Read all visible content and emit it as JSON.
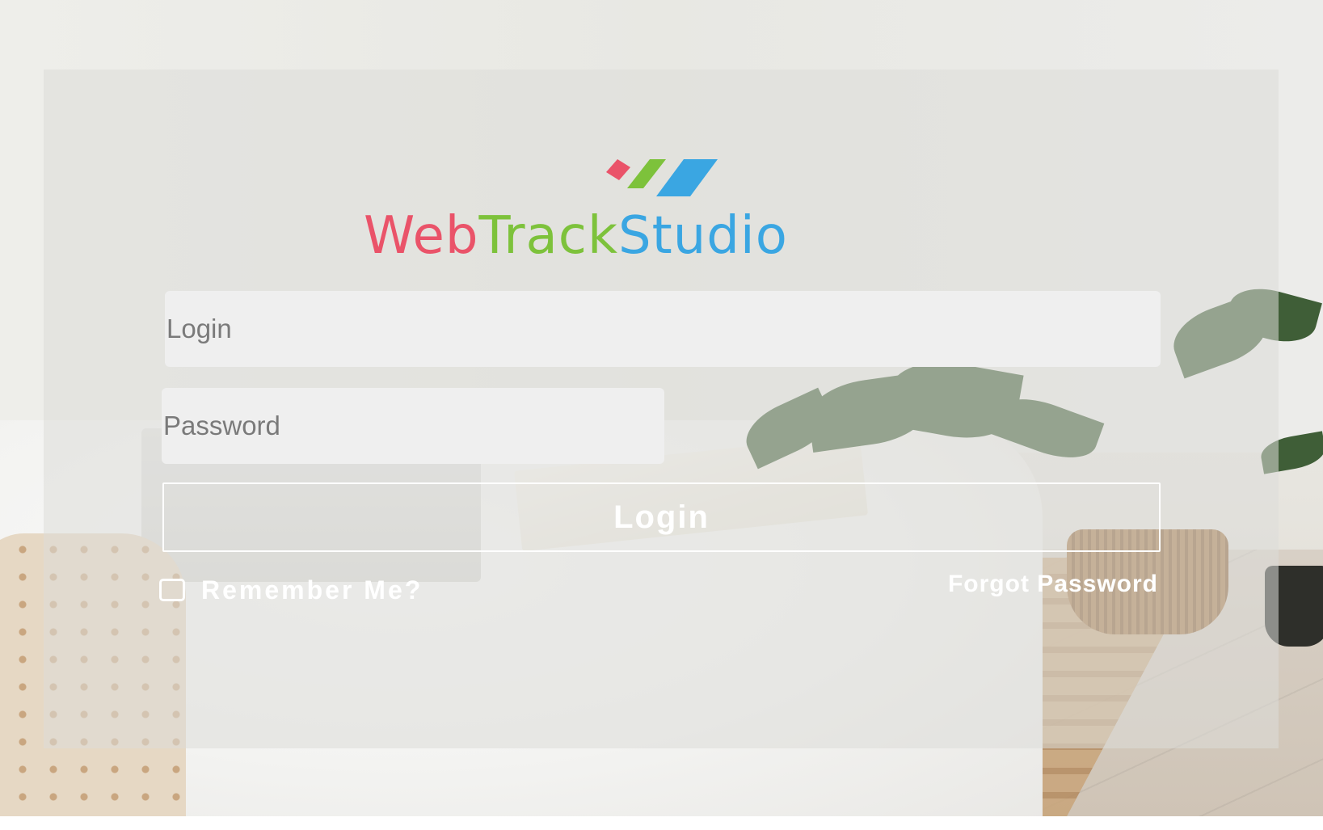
{
  "brand": {
    "name_part1": "Web",
    "name_part2": "Track",
    "name_part3": "Studio",
    "colors": {
      "pink": "#ea5369",
      "green": "#7dc23b",
      "blue": "#3aa6e2"
    }
  },
  "form": {
    "login_placeholder": "Login",
    "login_value": "",
    "password_placeholder": "Password",
    "password_value": "",
    "submit_label": "Login",
    "remember_label": "Remember Me?",
    "remember_checked": false,
    "forgot_label": "Forgot Password"
  }
}
